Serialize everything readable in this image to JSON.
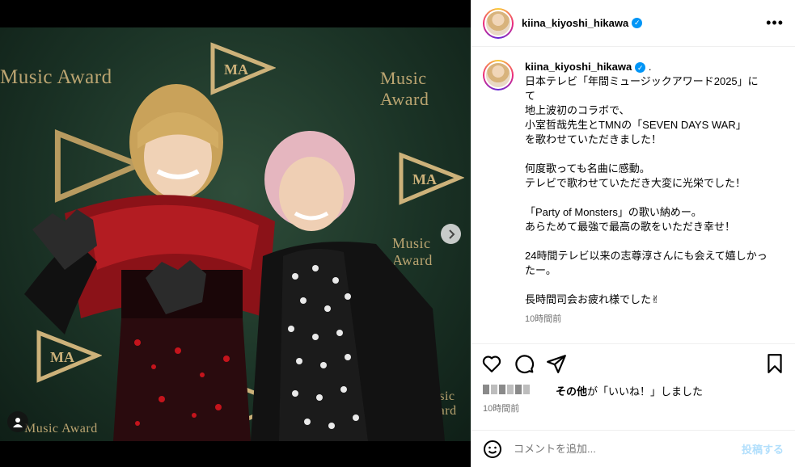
{
  "post": {
    "username": "kiina_kiyoshi_hikawa",
    "more_label": "•••",
    "caption_suffix": ".",
    "caption_lines": [
      "日本テレビ「年間ミュージックアワード2025」に",
      "て",
      "地上波初のコラボで、",
      "小室哲哉先生とTMNの「SEVEN DAYS WAR」",
      "を歌わせていただきました！",
      "",
      "何度歌っても名曲に感動。",
      "テレビで歌わせていただき大変に光栄でした！",
      "",
      "「Party of Monsters」の歌い納めー。",
      "あらためて最強で最高の歌をいただき幸せ！",
      "",
      "24時間テレビ以来の志尊淳さんにも会えて嬉しかっ",
      "たー。",
      "",
      "長時間司会お疲れ様でした✌"
    ],
    "caption_time": "10時間前",
    "likes_text_bold": "その他",
    "likes_text_rest": "が「いいね！」しました",
    "likes_time": "10時間前"
  },
  "media": {
    "backdrop_text": "Music Award",
    "next_icon": "chevron-right-icon",
    "tag_icon": "user-tag-icon"
  },
  "comment": {
    "placeholder": "コメントを追加...",
    "post_label": "投稿する",
    "emoji_icon": "emoji-icon"
  },
  "colors": {
    "verified": "#0095f6",
    "muted": "#737373",
    "post_button": "#b2dffc",
    "backdrop": "#1b3326",
    "gold": "#cdb27a"
  }
}
